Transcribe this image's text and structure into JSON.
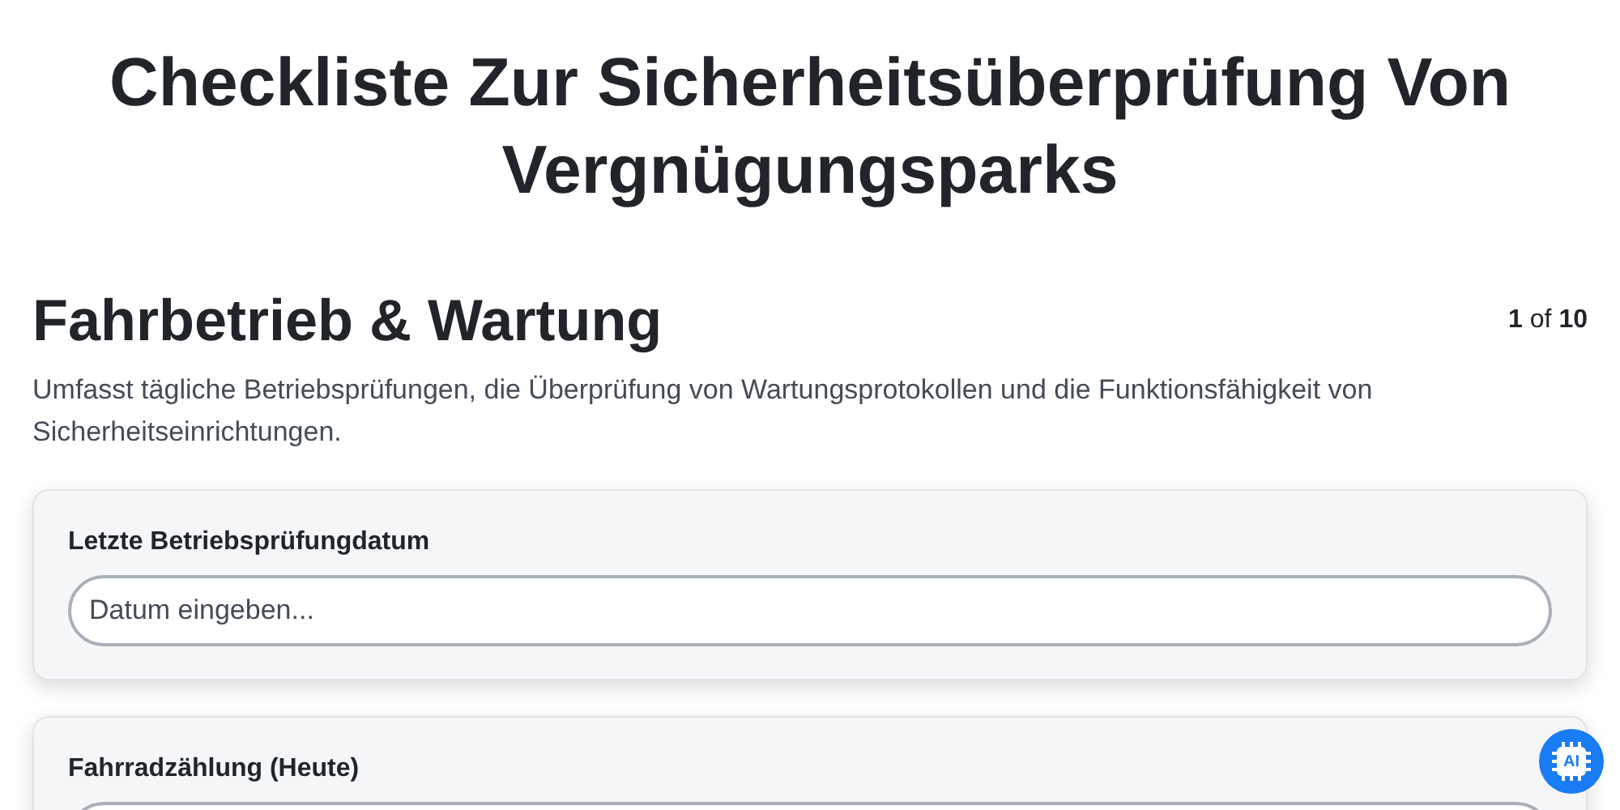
{
  "title": "Checkliste Zur Sicherheitsüberprüfung Von Vergnügungsparks",
  "section": {
    "heading": "Fahrbetrieb & Wartung",
    "page_current": "1",
    "page_of": "of",
    "page_total": "10",
    "description": "Umfasst tägliche Betriebsprüfungen, die Überprüfung von Wartungsprotokollen und die Funktionsfähigkeit von Sicherheitseinrichtungen."
  },
  "fields": [
    {
      "label": "Letzte Betriebsprüfungdatum",
      "placeholder": "Datum eingeben..."
    },
    {
      "label": "Fahrradzählung (Heute)"
    }
  ],
  "assistant_button": {
    "label": "AI"
  }
}
